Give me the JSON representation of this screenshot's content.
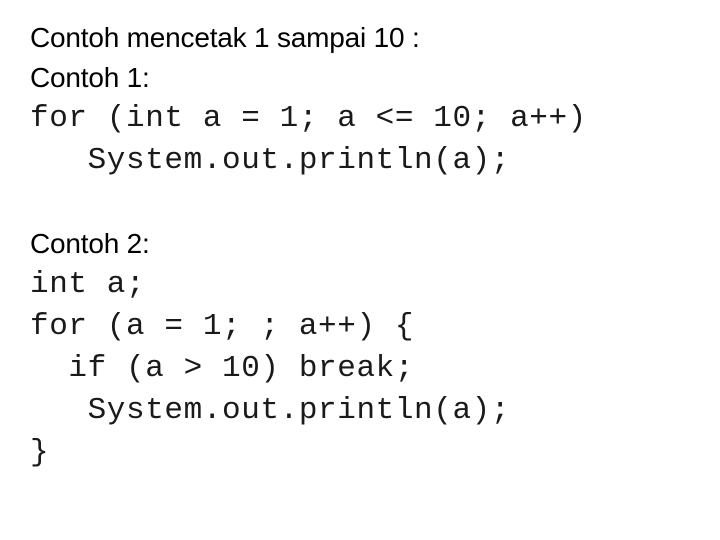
{
  "slide": {
    "background_color": "#ffffff",
    "text_color": "#000000",
    "intro_line": "Contoh mencetak 1 sampai 10 :",
    "examples": [
      {
        "heading": "Contoh 1:",
        "code_lines": [
          "for (int a = 1; a <= 10; a++)",
          "   System.out.println(a);"
        ]
      },
      {
        "heading": "Contoh 2:",
        "code_lines": [
          "int a;",
          "for (a = 1; ; a++) {",
          "  if (a > 10) break;",
          "   System.out.println(a);",
          "}"
        ]
      }
    ]
  }
}
